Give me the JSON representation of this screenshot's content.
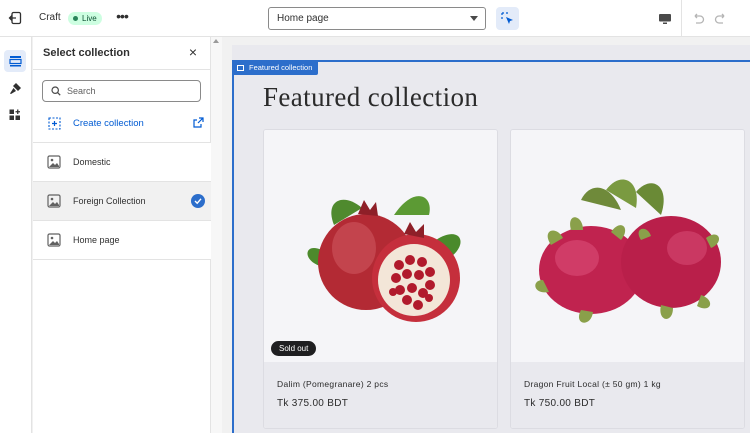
{
  "topbar": {
    "theme_name": "Craft",
    "status_badge": "Live",
    "template_select": {
      "selected": "Home page"
    }
  },
  "panel": {
    "title": "Select collection",
    "search": {
      "placeholder": "Search",
      "value": ""
    },
    "create_label": "Create collection",
    "collections": [
      {
        "label": "Domestic",
        "selected": false
      },
      {
        "label": "Foreign Collection",
        "selected": true
      },
      {
        "label": "Home page",
        "selected": false
      }
    ]
  },
  "preview": {
    "section_tag": "Featured collection",
    "heading": "Featured collection",
    "products": [
      {
        "title": "Dalim (Pomegranare) 2 pcs",
        "price": "Tk 375.00 BDT",
        "badge": "Sold out"
      },
      {
        "title": "Dragon Fruit Local (± 50 gm) 1 kg",
        "price": "Tk 750.00 BDT"
      }
    ]
  },
  "colors": {
    "accent": "#2c6ecb",
    "link": "#005bd3",
    "live_bg": "#cdfee1",
    "live_text": "#0c5132"
  },
  "icons": [
    "exit-icon",
    "more-icon",
    "inspector-icon",
    "desktop-icon",
    "undo-icon",
    "redo-icon",
    "sections-icon",
    "theme-settings-icon",
    "apps-icon",
    "search-icon",
    "create-collection-icon",
    "external-link-icon",
    "image-placeholder-icon",
    "checkmark-icon",
    "close-icon"
  ]
}
